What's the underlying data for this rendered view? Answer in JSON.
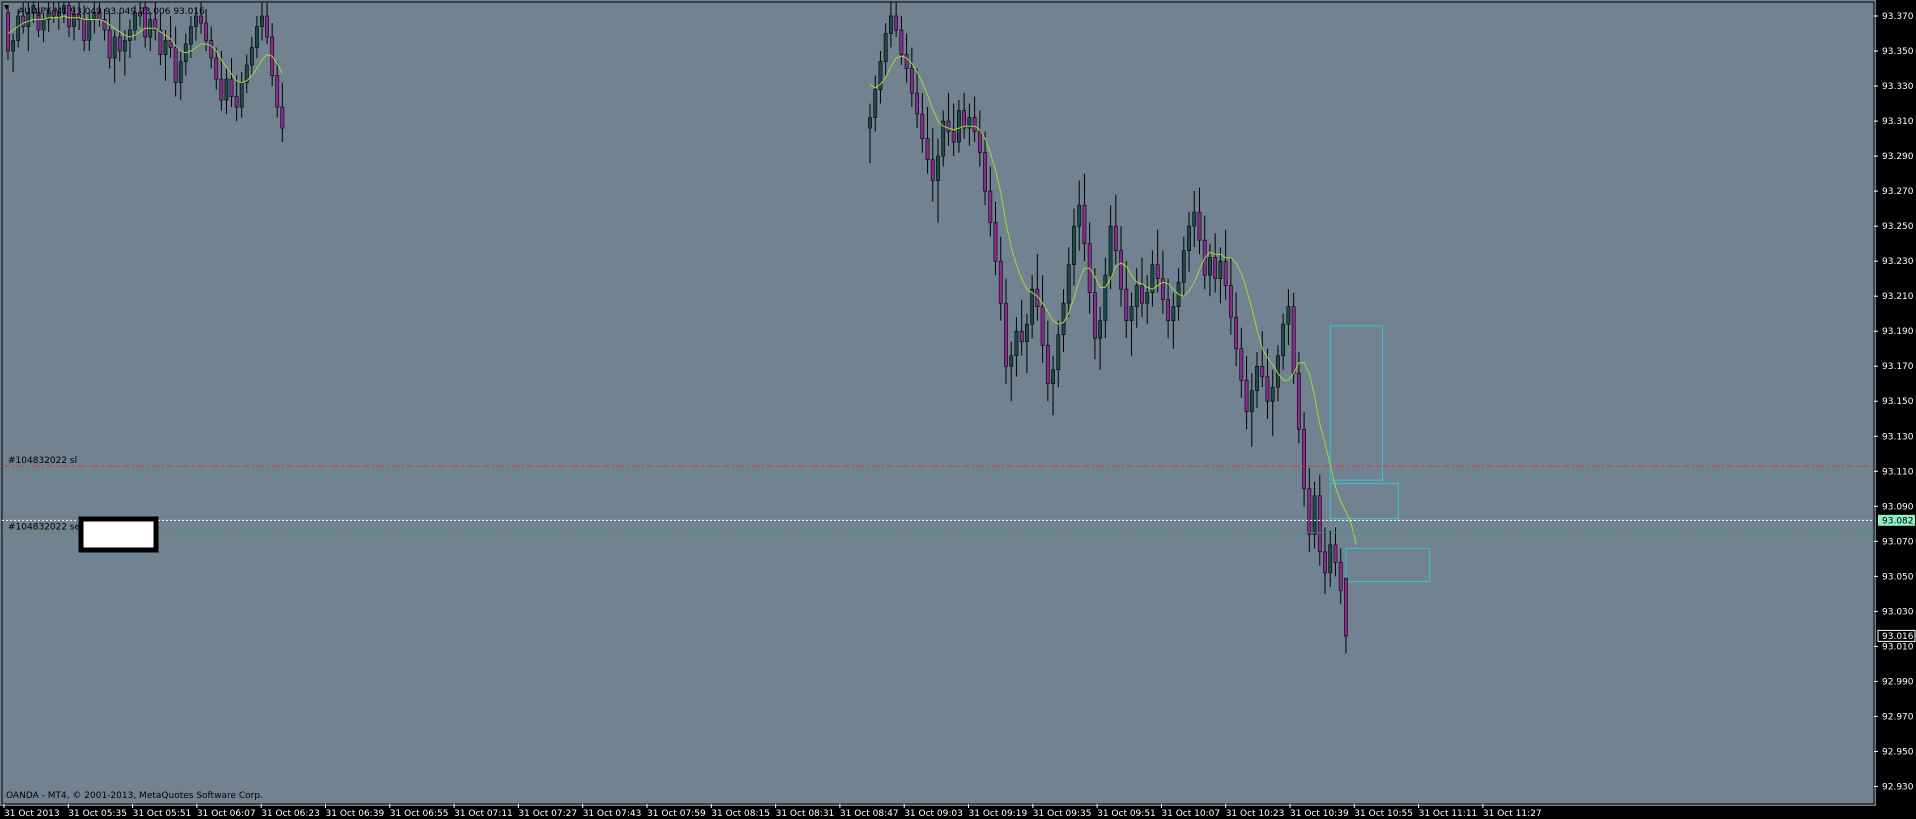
{
  "window": {
    "symbol_line": "AUDJPY,M1  93.049 93.049 93.006 93.016",
    "copyright": "OANDA - MT4, © 2001-2013, MetaQuotes Software Corp."
  },
  "colors": {
    "background": "#718291",
    "frame": "#000000",
    "bull_candle": "#1f4a4a",
    "bear_candle": "#8b2b8f",
    "wick": "#000000",
    "moving_average": "#9ed93a",
    "sl_line": "#d23a3a",
    "order_line": "#22aa55",
    "bid_line": "#ffffff",
    "zone_box": "#35c6d6",
    "bid_tag": "#8ff0c8"
  },
  "orders": {
    "sl_label": "#104832022 sl",
    "sell_label": "#104832022 sell",
    "sl_price": 93.113,
    "sell_price": 93.075
  },
  "price_axis": {
    "ticks": [
      "93.370",
      "93.350",
      "93.330",
      "93.310",
      "93.290",
      "93.270",
      "93.250",
      "93.230",
      "93.210",
      "93.190",
      "93.170",
      "93.150",
      "93.130",
      "93.110",
      "93.090",
      "93.070",
      "93.050",
      "93.030",
      "93.010",
      "92.990",
      "92.970",
      "92.950",
      "92.930"
    ],
    "bid_label": "93.082",
    "last_label": "93.016",
    "bid_price": 93.082,
    "last_price": 93.016
  },
  "time_axis": {
    "labels": [
      "31 Oct 2013",
      "31 Oct 05:35",
      "31 Oct 05:51",
      "31 Oct 06:07",
      "31 Oct 06:23",
      "31 Oct 06:39",
      "31 Oct 06:55",
      "31 Oct 07:11",
      "31 Oct 07:27",
      "31 Oct 07:43",
      "31 Oct 07:59",
      "31 Oct 08:15",
      "31 Oct 08:31",
      "31 Oct 08:47",
      "31 Oct 09:03",
      "31 Oct 09:19",
      "31 Oct 09:35",
      "31 Oct 09:51",
      "31 Oct 10:07",
      "31 Oct 10:23",
      "31 Oct 10:39",
      "31 Oct 10:55",
      "31 Oct 11:11",
      "31 Oct 11:27"
    ]
  },
  "chart_data": {
    "type": "candlestick",
    "symbol": "AUDJPY",
    "timeframe": "M1",
    "ylim": [
      92.92,
      93.378
    ],
    "candles": [
      [
        93.372,
        93.376,
        93.345,
        93.35
      ],
      [
        93.35,
        93.36,
        93.338,
        93.356
      ],
      [
        93.356,
        93.374,
        93.352,
        93.37
      ],
      [
        93.37,
        93.378,
        93.36,
        93.364
      ],
      [
        93.364,
        93.378,
        93.35,
        93.372
      ],
      [
        93.372,
        93.378,
        93.366,
        93.376
      ],
      [
        93.372,
        93.378,
        93.358,
        93.362
      ],
      [
        93.362,
        93.372,
        93.355,
        93.368
      ],
      [
        93.368,
        93.378,
        93.361,
        93.373
      ],
      [
        93.373,
        93.378,
        93.366,
        93.37
      ],
      [
        93.37,
        93.378,
        93.362,
        93.372
      ],
      [
        93.372,
        93.378,
        93.366,
        93.376
      ],
      [
        93.376,
        93.378,
        93.358,
        93.364
      ],
      [
        93.364,
        93.376,
        93.356,
        93.371
      ],
      [
        93.371,
        93.378,
        93.362,
        93.368
      ],
      [
        93.368,
        93.376,
        93.35,
        93.356
      ],
      [
        93.356,
        93.372,
        93.35,
        93.368
      ],
      [
        93.368,
        93.378,
        93.36,
        93.372
      ],
      [
        93.372,
        93.378,
        93.364,
        93.368
      ],
      [
        93.368,
        93.374,
        93.356,
        93.362
      ],
      [
        93.362,
        93.372,
        93.34,
        93.346
      ],
      [
        93.346,
        93.362,
        93.332,
        93.358
      ],
      [
        93.358,
        93.372,
        93.344,
        93.35
      ],
      [
        93.35,
        93.362,
        93.336,
        93.356
      ],
      [
        93.356,
        93.368,
        93.346,
        93.362
      ],
      [
        93.362,
        93.376,
        93.356,
        93.372
      ],
      [
        93.372,
        93.378,
        93.364,
        93.37
      ],
      [
        93.375,
        93.378,
        93.352,
        93.358
      ],
      [
        93.358,
        93.372,
        93.35,
        93.368
      ],
      [
        93.368,
        93.378,
        93.356,
        93.362
      ],
      [
        93.362,
        93.372,
        93.342,
        93.348
      ],
      [
        93.348,
        93.362,
        93.333,
        93.356
      ],
      [
        93.356,
        93.37,
        93.346,
        93.352
      ],
      [
        93.352,
        93.364,
        93.324,
        93.332
      ],
      [
        93.332,
        93.35,
        93.322,
        93.344
      ],
      [
        93.344,
        93.36,
        93.336,
        93.354
      ],
      [
        93.354,
        93.37,
        93.346,
        93.364
      ],
      [
        93.364,
        93.375,
        93.356,
        93.37
      ],
      [
        93.37,
        93.378,
        93.36,
        93.366
      ],
      [
        93.366,
        93.374,
        93.35,
        93.356
      ],
      [
        93.356,
        93.364,
        93.34,
        93.346
      ],
      [
        93.346,
        93.352,
        93.328,
        93.334
      ],
      [
        93.334,
        93.35,
        93.316,
        93.322
      ],
      [
        93.322,
        93.34,
        93.314,
        93.334
      ],
      [
        93.334,
        93.346,
        93.318,
        93.324
      ],
      [
        93.324,
        93.336,
        93.31,
        93.318
      ],
      [
        93.318,
        93.338,
        93.312,
        93.332
      ],
      [
        93.332,
        93.348,
        93.326,
        93.342
      ],
      [
        93.342,
        93.358,
        93.336,
        93.352
      ],
      [
        93.352,
        93.37,
        93.346,
        93.364
      ],
      [
        93.364,
        93.378,
        93.356,
        93.37
      ],
      [
        93.37,
        93.378,
        93.354,
        93.358
      ],
      [
        93.358,
        93.366,
        93.33,
        93.336
      ],
      [
        93.336,
        93.344,
        93.312,
        93.318
      ],
      [
        93.318,
        93.332,
        93.298,
        93.306
      ],
      [
        93.306,
        93.32,
        93.286,
        93.312
      ],
      [
        93.312,
        93.336,
        93.304,
        93.328
      ],
      [
        93.328,
        93.35,
        93.32,
        93.344
      ],
      [
        93.344,
        93.366,
        93.336,
        93.36
      ],
      [
        93.36,
        93.378,
        93.352,
        93.37
      ],
      [
        93.37,
        93.378,
        93.358,
        93.362
      ],
      [
        93.362,
        93.37,
        93.342,
        93.348
      ],
      [
        93.348,
        93.36,
        93.332,
        93.34
      ],
      [
        93.34,
        93.352,
        93.318,
        93.326
      ],
      [
        93.326,
        93.34,
        93.306,
        93.314
      ],
      [
        93.314,
        93.326,
        93.292,
        93.3
      ],
      [
        93.3,
        93.318,
        93.28,
        93.288
      ],
      [
        93.288,
        93.306,
        93.264,
        93.276
      ],
      [
        93.276,
        93.3,
        93.252,
        93.29
      ],
      [
        93.29,
        93.316,
        93.284,
        93.31
      ],
      [
        93.31,
        93.326,
        93.296,
        93.304
      ],
      [
        93.304,
        93.32,
        93.29,
        93.298
      ],
      [
        93.298,
        93.322,
        93.292,
        93.316
      ],
      [
        93.316,
        93.326,
        93.3,
        93.306
      ],
      [
        93.306,
        93.32,
        93.296,
        93.312
      ],
      [
        93.312,
        93.324,
        93.298,
        93.304
      ],
      [
        93.304,
        93.316,
        93.284,
        93.292
      ],
      [
        93.292,
        93.304,
        93.262,
        93.27
      ],
      [
        93.27,
        93.284,
        93.244,
        93.252
      ],
      [
        93.252,
        93.264,
        93.222,
        93.23
      ],
      [
        93.23,
        93.244,
        93.196,
        93.206
      ],
      [
        93.206,
        93.22,
        93.16,
        93.17
      ],
      [
        93.17,
        93.184,
        93.15,
        93.176
      ],
      [
        93.176,
        93.198,
        93.164,
        93.19
      ],
      [
        93.19,
        93.208,
        93.176,
        93.184
      ],
      [
        93.184,
        93.2,
        93.166,
        93.194
      ],
      [
        93.194,
        93.222,
        93.186,
        93.214
      ],
      [
        93.214,
        93.234,
        93.196,
        93.204
      ],
      [
        93.204,
        93.222,
        93.172,
        93.182
      ],
      [
        93.182,
        93.196,
        93.15,
        93.16
      ],
      [
        93.16,
        93.176,
        93.142,
        93.168
      ],
      [
        93.168,
        93.196,
        93.158,
        93.188
      ],
      [
        93.188,
        93.214,
        93.178,
        93.206
      ],
      [
        93.206,
        93.238,
        93.198,
        93.228
      ],
      [
        93.228,
        93.26,
        93.216,
        93.25
      ],
      [
        93.25,
        93.276,
        93.236,
        93.262
      ],
      [
        93.262,
        93.28,
        93.23,
        93.24
      ],
      [
        93.24,
        93.252,
        93.2,
        93.212
      ],
      [
        93.212,
        93.226,
        93.174,
        93.186
      ],
      [
        93.186,
        93.204,
        93.168,
        93.196
      ],
      [
        93.196,
        93.232,
        93.186,
        93.222
      ],
      [
        93.222,
        93.262,
        93.214,
        93.25
      ],
      [
        93.25,
        93.268,
        93.228,
        93.236
      ],
      [
        93.236,
        93.25,
        93.204,
        93.214
      ],
      [
        93.214,
        93.23,
        93.186,
        93.196
      ],
      [
        93.196,
        93.212,
        93.176,
        93.204
      ],
      [
        93.204,
        93.226,
        93.192,
        93.216
      ],
      [
        93.216,
        93.232,
        93.198,
        93.206
      ],
      [
        93.206,
        93.222,
        93.194,
        93.212
      ],
      [
        93.212,
        93.236,
        93.204,
        93.228
      ],
      [
        93.228,
        93.248,
        93.212,
        93.22
      ],
      [
        93.22,
        93.236,
        93.2,
        93.208
      ],
      [
        93.208,
        93.22,
        93.186,
        93.196
      ],
      [
        93.196,
        93.212,
        93.18,
        93.204
      ],
      [
        93.204,
        93.226,
        93.196,
        93.218
      ],
      [
        93.218,
        93.244,
        93.21,
        93.236
      ],
      [
        93.236,
        93.258,
        93.224,
        93.25
      ],
      [
        93.25,
        93.27,
        93.238,
        93.258
      ],
      [
        93.258,
        93.272,
        93.234,
        93.242
      ],
      [
        93.242,
        93.256,
        93.214,
        93.222
      ],
      [
        93.222,
        93.24,
        93.21,
        93.232
      ],
      [
        93.232,
        93.246,
        93.212,
        93.22
      ],
      [
        93.22,
        93.238,
        93.206,
        93.23
      ],
      [
        93.23,
        93.248,
        93.208,
        93.216
      ],
      [
        93.216,
        93.232,
        93.188,
        93.198
      ],
      [
        93.198,
        93.212,
        93.17,
        93.18
      ],
      [
        93.18,
        93.192,
        93.152,
        93.162
      ],
      [
        93.162,
        93.176,
        93.134,
        93.144
      ],
      [
        93.144,
        93.166,
        93.124,
        93.156
      ],
      [
        93.156,
        93.178,
        93.146,
        93.17
      ],
      [
        93.17,
        93.19,
        93.158,
        93.164
      ],
      [
        93.164,
        93.18,
        93.14,
        93.15
      ],
      [
        93.15,
        93.168,
        93.13,
        93.158
      ],
      [
        93.158,
        93.182,
        93.15,
        93.176
      ],
      [
        93.176,
        93.2,
        93.168,
        93.194
      ],
      [
        93.194,
        93.214,
        93.182,
        93.204
      ],
      [
        93.204,
        93.212,
        93.16,
        93.166
      ],
      [
        93.166,
        93.178,
        93.126,
        93.134
      ],
      [
        93.134,
        93.144,
        93.09,
        93.1
      ],
      [
        93.1,
        93.112,
        93.064,
        93.074
      ],
      [
        93.074,
        93.104,
        93.066,
        93.096
      ],
      [
        93.096,
        93.108,
        93.056,
        93.064
      ],
      [
        93.064,
        93.078,
        93.04,
        93.052
      ],
      [
        93.052,
        93.076,
        93.044,
        93.068
      ],
      [
        93.068,
        93.078,
        93.05,
        93.058
      ],
      [
        93.058,
        93.066,
        93.034,
        93.042
      ],
      [
        93.049,
        93.049,
        93.006,
        93.016
      ]
    ],
    "moving_average": [
      93.36,
      93.362,
      93.364,
      93.366,
      93.367,
      93.368,
      93.368,
      93.368,
      93.369,
      93.369,
      93.369,
      93.37,
      93.369,
      93.369,
      93.369,
      93.368,
      93.368,
      93.368,
      93.368,
      93.367,
      93.365,
      93.363,
      93.361,
      93.359,
      93.358,
      93.359,
      93.361,
      93.363,
      93.363,
      93.363,
      93.361,
      93.359,
      93.357,
      93.353,
      93.35,
      93.349,
      93.35,
      93.352,
      93.354,
      93.354,
      93.353,
      93.35,
      93.345,
      93.341,
      93.337,
      93.333,
      93.332,
      93.333,
      93.336,
      93.34,
      93.345,
      93.348,
      93.347,
      93.343,
      93.337,
      93.331,
      93.329,
      93.331,
      93.335,
      93.341,
      93.346,
      93.347,
      93.346,
      93.343,
      93.338,
      93.332,
      93.325,
      93.317,
      93.31,
      93.307,
      93.306,
      93.305,
      93.306,
      93.307,
      93.307,
      93.307,
      93.305,
      93.3,
      93.292,
      93.282,
      93.269,
      93.252,
      93.238,
      93.228,
      93.22,
      93.214,
      93.212,
      93.21,
      93.206,
      93.201,
      93.196,
      93.194,
      93.195,
      93.2,
      93.209,
      93.219,
      93.226,
      93.226,
      93.221,
      93.215,
      93.215,
      93.22,
      93.227,
      93.229,
      93.227,
      93.222,
      93.218,
      93.217,
      93.215,
      93.214,
      93.216,
      93.218,
      93.217,
      93.214,
      93.211,
      93.21,
      93.213,
      93.218,
      93.225,
      93.232,
      93.235,
      93.234,
      93.234,
      93.232,
      93.232,
      93.229,
      93.223,
      93.214,
      93.203,
      93.191,
      93.18,
      93.175,
      93.171,
      93.166,
      93.162,
      93.162,
      93.166,
      93.172,
      93.172,
      93.166,
      93.153,
      93.137,
      93.126,
      93.114,
      93.101,
      93.093,
      93.087,
      93.08,
      93.068
    ],
    "zones": [
      {
        "start_index": 143,
        "width_bars": 10,
        "top": 93.193,
        "bottom": 93.105
      },
      {
        "start_index": 143,
        "width_bars": 13,
        "top": 93.103,
        "bottom": 93.083
      },
      {
        "start_index": 146,
        "width_bars": 16,
        "top": 93.066,
        "bottom": 93.047
      }
    ]
  }
}
